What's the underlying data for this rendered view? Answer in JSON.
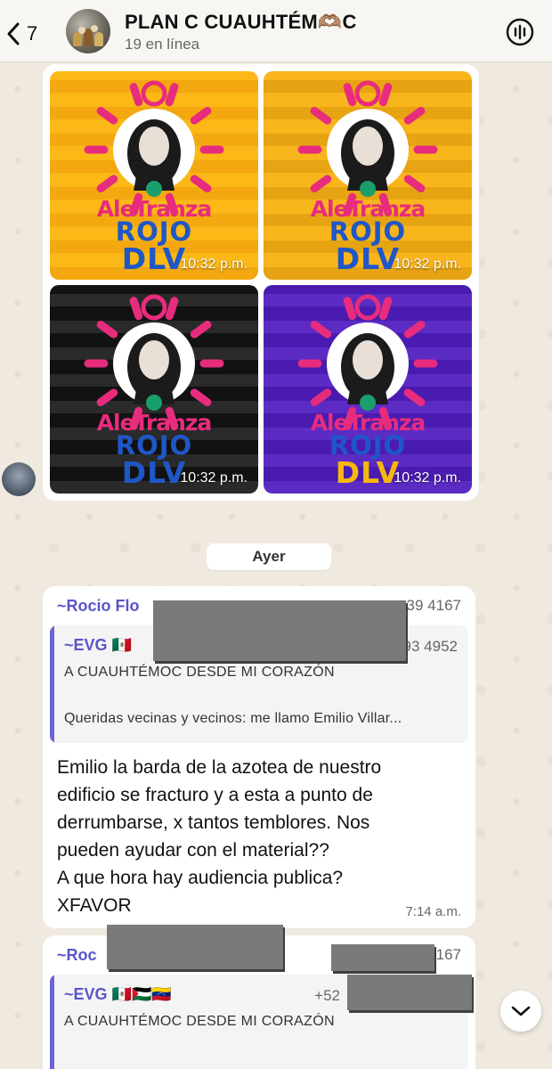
{
  "header": {
    "back_count": "7",
    "title": "PLAN C CUAUHTÉM🫶🏽C",
    "subtitle": "19 en línea"
  },
  "media": {
    "tiles": [
      {
        "time": "10:32 p.m.",
        "bg": "#fbb816",
        "pattern": "#f3a810",
        "line1": "AleTranza",
        "line2": "ROJO",
        "line3": "DLV",
        "line3_color": "#1f57c7"
      },
      {
        "time": "10:32 p.m.",
        "bg": "#f9b51c",
        "pattern": "#e6a312",
        "line1": "AleTranza",
        "line2": "ROJO",
        "line3": "DLV",
        "line3_color": "#1f57c7"
      },
      {
        "time": "10:32 p.m.",
        "bg": "#121212",
        "pattern": "#2a2a2a",
        "line1": "AleTranza",
        "line2": "ROJO",
        "line3": "DLV",
        "line3_color": "#1f57c7"
      },
      {
        "time": "10:32 p.m.",
        "bg": "#4a1bb0",
        "pattern": "#5b2bc4",
        "line1": "AleTranza",
        "line2": "ROJO",
        "line3": "DLV",
        "line3_color": "#f7b80c"
      }
    ]
  },
  "date_chip": "Ayer",
  "messages": [
    {
      "sender": "~Rocio Flo",
      "phone_tail": "39 4167",
      "quote": {
        "name": "~EVG 🇲🇽",
        "phone_tail": "93 4952",
        "title": "A CUAUHTÉMOC DESDE MI CORAZÓN",
        "body": "Queridas vecinas y vecinos: me llamo Emilio Villar..."
      },
      "text": "Emilio la barda de la azotea de nuestro\nedificio se fracturo y a esta a punto de\nderrumbarse, x tantos temblores.  Nos\npueden ayudar con el material??\nA que hora hay audiencia publica?\nXFAVOR",
      "time": "7:14 a.m."
    },
    {
      "sender": "~Roc",
      "phone_prefix": "+",
      "phone_tail": "167",
      "quote": {
        "name": "~EVG 🇲🇽🇵🇸🇻🇪",
        "phone_tail": "+52",
        "title": "A CUAUHTÉMOC DESDE MI CORAZÓN"
      }
    }
  ],
  "colors": {
    "accent_name": "#5a56c8",
    "quote_bar": "#6c63d6",
    "chat_bg": "#efe9df"
  }
}
